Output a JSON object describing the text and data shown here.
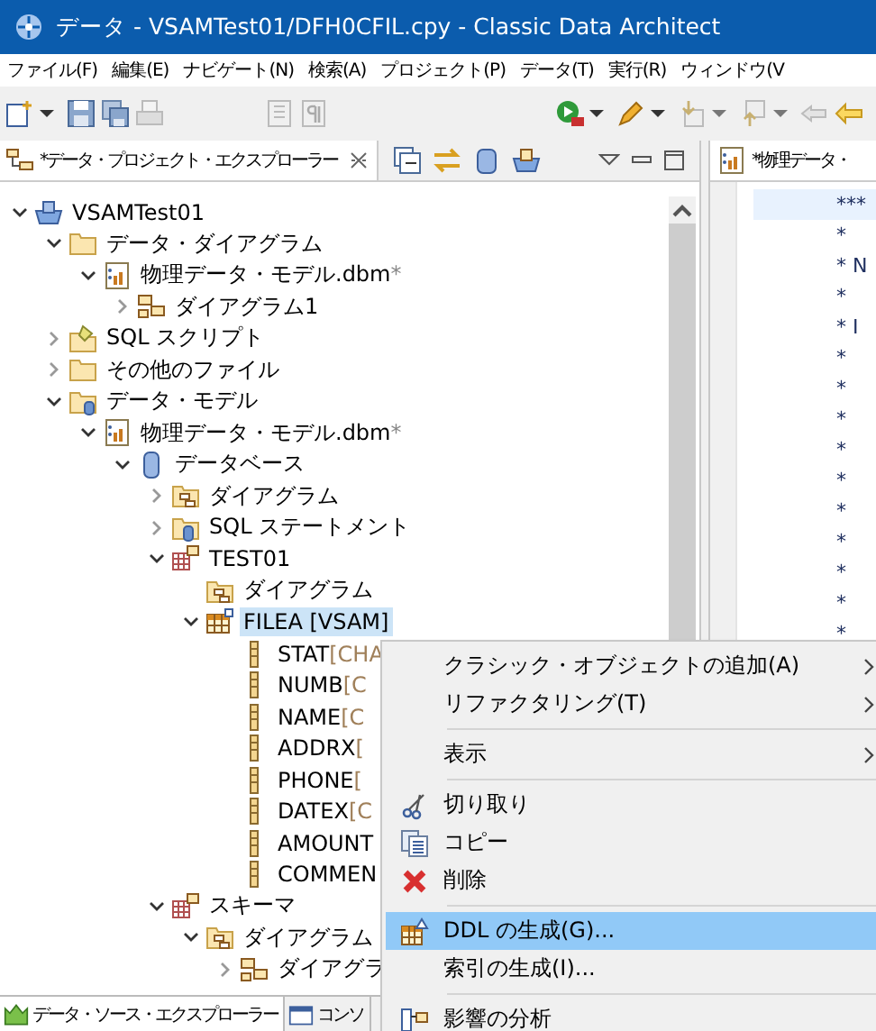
{
  "window": {
    "title": "データ - VSAMTest01/DFH0CFIL.cpy - Classic Data Architect"
  },
  "menu_bar": [
    "ファイル(F)",
    "編集(E)",
    "ナビゲート(N)",
    "検索(A)",
    "プロジェクト(P)",
    "データ(T)",
    "実行(R)",
    "ウィンドウ(V"
  ],
  "explorer": {
    "tab_title": "*データ・プロジェクト・エクスプローラー",
    "tree": [
      {
        "label": "VSAMTest01",
        "kind": "project",
        "expanded": true,
        "selected": false,
        "children": [
          {
            "label": "データ・ダイアグラム",
            "kind": "folder",
            "expanded": true,
            "selected": false,
            "children": [
              {
                "label": "物理データ・モデル.dbm",
                "suffix": "*",
                "kind": "model",
                "expanded": true,
                "selected": false,
                "children": [
                  {
                    "label": "ダイアグラム1",
                    "kind": "diagram",
                    "expanded": false,
                    "selected": false
                  }
                ]
              }
            ]
          },
          {
            "label": "SQL スクリプト",
            "kind": "script",
            "expanded": false,
            "selected": false
          },
          {
            "label": "その他のファイル",
            "kind": "folder",
            "expanded": false,
            "selected": false
          },
          {
            "label": "データ・モデル",
            "kind": "datafolder",
            "expanded": true,
            "selected": false,
            "children": [
              {
                "label": "物理データ・モデル.dbm",
                "suffix": "*",
                "kind": "model",
                "expanded": true,
                "selected": false,
                "children": [
                  {
                    "label": "データベース",
                    "kind": "database",
                    "expanded": true,
                    "selected": false,
                    "children": [
                      {
                        "label": "ダイアグラム",
                        "kind": "diagramfolder",
                        "expanded": false,
                        "selected": false
                      },
                      {
                        "label": "SQL ステートメント",
                        "kind": "sqlfolder",
                        "expanded": false,
                        "selected": false
                      },
                      {
                        "label": "TEST01",
                        "kind": "schema",
                        "expanded": true,
                        "selected": false,
                        "children": [
                          {
                            "label": "ダイアグラム",
                            "kind": "diagramfolder",
                            "selected": false
                          },
                          {
                            "label": "FILEA [VSAM]",
                            "kind": "table",
                            "expanded": true,
                            "selected": true,
                            "children": [
                              {
                                "label": "STAT",
                                "detail": "[CHA",
                                "kind": "column",
                                "selected": false
                              },
                              {
                                "label": "NUMB",
                                "detail": "[C",
                                "kind": "column",
                                "selected": false
                              },
                              {
                                "label": "NAME",
                                "detail": "[C",
                                "kind": "column",
                                "selected": false
                              },
                              {
                                "label": "ADDRX",
                                "detail": "[",
                                "kind": "column",
                                "selected": false
                              },
                              {
                                "label": "PHONE",
                                "detail": "[",
                                "kind": "column",
                                "selected": false
                              },
                              {
                                "label": "DATEX",
                                "detail": "[C",
                                "kind": "column",
                                "selected": false
                              },
                              {
                                "label": "AMOUNT",
                                "kind": "column",
                                "selected": false
                              },
                              {
                                "label": "COMMEN",
                                "kind": "column",
                                "selected": false
                              }
                            ]
                          }
                        ]
                      },
                      {
                        "label": "スキーマ",
                        "kind": "schema",
                        "expanded": true,
                        "selected": false,
                        "children": [
                          {
                            "label": "ダイアグラム",
                            "kind": "diagramfolder",
                            "expanded": true,
                            "selected": false,
                            "children": [
                              {
                                "label": "ダイアグラ",
                                "kind": "diagram",
                                "expanded": false,
                                "selected": false
                              }
                            ]
                          }
                        ]
                      }
                    ]
                  }
                ]
              }
            ]
          }
        ]
      }
    ]
  },
  "editor": {
    "tab_title": "*物理データ・",
    "lines": [
      {
        "text": "***",
        "current": true
      },
      {
        "text": "*",
        "current": false
      },
      {
        "text": "* N",
        "current": false
      },
      {
        "text": "*",
        "current": false
      },
      {
        "text": "* I",
        "current": false
      },
      {
        "text": "*",
        "current": false
      },
      {
        "text": "*",
        "current": false
      },
      {
        "text": "*",
        "current": false
      },
      {
        "text": "*",
        "current": false
      },
      {
        "text": "*",
        "current": false
      },
      {
        "text": "*",
        "current": false
      },
      {
        "text": "*",
        "current": false
      },
      {
        "text": "*",
        "current": false
      },
      {
        "text": "*",
        "current": false
      },
      {
        "text": "*",
        "current": false
      }
    ]
  },
  "bottom_tabs": [
    "データ・ソース・エクスプローラー",
    "コンソ"
  ],
  "context_menu": [
    {
      "kind": "item",
      "label": "クラシック・オブジェクトの追加(A)",
      "submenu": true,
      "selected": false
    },
    {
      "kind": "item",
      "label": "リファクタリング(T)",
      "submenu": true,
      "selected": false
    },
    {
      "kind": "separator"
    },
    {
      "kind": "item",
      "label": "表示",
      "submenu": true,
      "selected": false
    },
    {
      "kind": "separator"
    },
    {
      "kind": "item",
      "label": "切り取り",
      "selected": false
    },
    {
      "kind": "item",
      "label": "コピー",
      "selected": false
    },
    {
      "kind": "item",
      "label": "削除",
      "selected": false
    },
    {
      "kind": "separator"
    },
    {
      "kind": "item",
      "label": "DDL の生成(G)...",
      "selected": true
    },
    {
      "kind": "item",
      "label": "索引の生成(I)...",
      "selected": false
    },
    {
      "kind": "separator"
    },
    {
      "kind": "item",
      "label": "影響の分析",
      "selected": false
    }
  ]
}
